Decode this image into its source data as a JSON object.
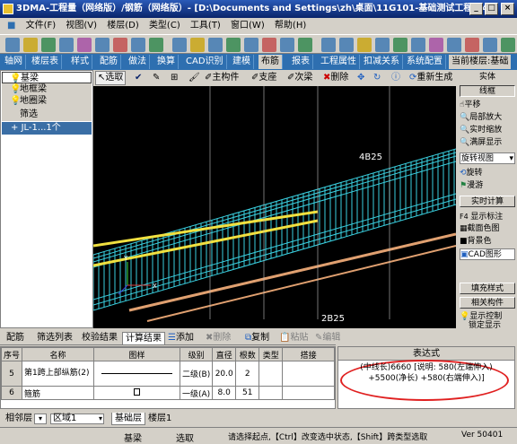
{
  "window": {
    "title": "3DMA-工程量（网络版）/钢筋（网络版）- [D:\\Documents and Settings\\zh\\桌面\\11G101-基础测试工程\\14..."
  },
  "menu": [
    "文件(F)",
    "视图(V)",
    "楼层(D)",
    "类型(C)",
    "工具(T)",
    "窗口(W)",
    "帮助(H)"
  ],
  "tabs": [
    "轴网",
    "楼层表",
    "样式",
    "配筋",
    "做法",
    "换算",
    "CAD识别",
    "建模",
    "布筋",
    "报表",
    "工程属性",
    "扣减关系",
    "系统配置"
  ],
  "current_floor": "当前楼层:基础",
  "toolbar2": {
    "select": "选取",
    "main_member": "主构件",
    "support": "支座",
    "secondary_beam": "次梁",
    "delete": "删除",
    "regenerate": "重新生成"
  },
  "left_panel": {
    "items": [
      "基梁",
      "地框梁",
      "地圈梁"
    ],
    "filter_label": "筛选",
    "tree_item": "JL-1...1个"
  },
  "viewport": {
    "label_top": "4B25",
    "label_bottom": "2B25"
  },
  "right_panel": {
    "entity": "实体",
    "wireframe": "线框",
    "pan": "平移",
    "zoom_window": "局部放大",
    "realtime_zoom": "实时缩放",
    "fit": "满屏显示",
    "rotate_view": "旋转视图",
    "rotate": "旋转",
    "roam": "漫游",
    "realtime_calc": "实时计算",
    "show_annotation": "显示标注",
    "section_color": "截面色图",
    "bg_color": "背景色",
    "cad_graphic": "CAD图形",
    "fill_style": "填充样式",
    "related_member": "相关构件",
    "display_control": "显示控制",
    "lock_display": "锁定显示"
  },
  "bottom_tabs": [
    "配筋",
    "筛选列表",
    "校验结果",
    "计算结果"
  ],
  "bottom_toolbar": {
    "add": "添加",
    "delete": "删除",
    "copy": "复制",
    "paste": "粘贴",
    "edit": "编辑"
  },
  "table": {
    "headers": [
      "序号",
      "名称",
      "图样",
      "级别",
      "直径",
      "根数",
      "类型",
      "搭接"
    ],
    "rows": [
      {
        "no": "5",
        "name": "第1跨上部纵筋(2)",
        "grade": "二级(B)",
        "dia": "20.0",
        "count": "2",
        "type": "",
        "lap": ""
      },
      {
        "no": "6",
        "name": "箍筋",
        "grade": "一级(A)",
        "dia": "8.0",
        "count": "51",
        "type": "",
        "lap": ""
      }
    ]
  },
  "expression": {
    "header": "表达式",
    "line1": "(中线长)6660 [说明: 580(左端伸入)",
    "line2": "+5500(净长) +580(右端伸入)]"
  },
  "status": {
    "floor": "相邻层",
    "zone": "区域1",
    "sheet_tabs": [
      "基础层",
      "楼层1"
    ],
    "member": "基梁",
    "mode": "选取",
    "hint": "请选择起点,【Ctrl】改变选中状态,【Shift】跨类型选取",
    "version": "Ver 50401"
  },
  "colors": {
    "tab_blue": "#2e6fb0",
    "title_blue": "#0a246a",
    "viewport_bg": "#000000",
    "rebar_cyan": "#3ad0e0",
    "rebar_yellow": "#f0e040",
    "rebar_orange": "#e0a070",
    "highlight_red": "#e02020"
  }
}
